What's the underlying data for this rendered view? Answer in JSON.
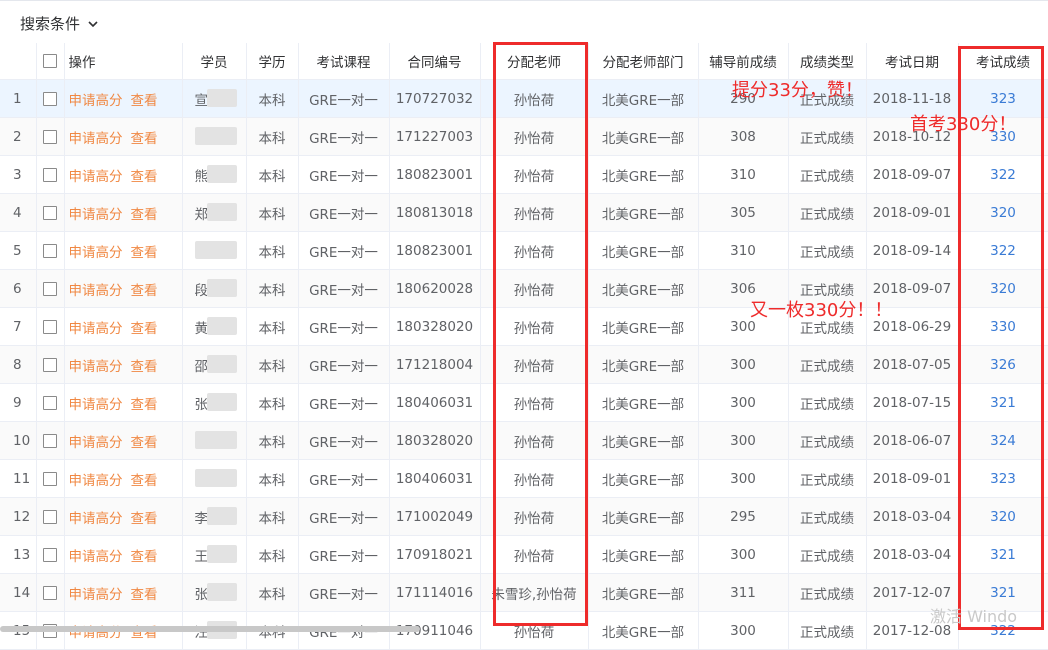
{
  "filter": {
    "label": "搜索条件"
  },
  "table": {
    "headers": {
      "ops": "操作",
      "student": "学员",
      "degree": "学历",
      "course": "考试课程",
      "contract": "合同编号",
      "teacher": "分配老师",
      "dept": "分配老师部门",
      "prescore": "辅导前成绩",
      "scoretype": "成绩类型",
      "date": "考试日期",
      "score": "考试成绩"
    },
    "actions": {
      "apply": "申请高分",
      "view": "查看"
    },
    "rows": [
      {
        "idx": "1",
        "name": "宣",
        "degree": "本科",
        "course": "GRE一对一",
        "contract": "170727032",
        "teacher": "孙怡荷",
        "dept": "北美GRE一部",
        "prescore": "290",
        "type": "正式成绩",
        "date": "2018-11-18",
        "score": "323"
      },
      {
        "idx": "2",
        "name": "",
        "degree": "本科",
        "course": "GRE一对一",
        "contract": "171227003",
        "teacher": "孙怡荷",
        "dept": "北美GRE一部",
        "prescore": "308",
        "type": "正式成绩",
        "date": "2018-10-12",
        "score": "330"
      },
      {
        "idx": "3",
        "name": "熊",
        "degree": "本科",
        "course": "GRE一对一",
        "contract": "180823001",
        "teacher": "孙怡荷",
        "dept": "北美GRE一部",
        "prescore": "310",
        "type": "正式成绩",
        "date": "2018-09-07",
        "score": "322"
      },
      {
        "idx": "4",
        "name": "郑",
        "degree": "本科",
        "course": "GRE一对一",
        "contract": "180813018",
        "teacher": "孙怡荷",
        "dept": "北美GRE一部",
        "prescore": "305",
        "type": "正式成绩",
        "date": "2018-09-01",
        "score": "320"
      },
      {
        "idx": "5",
        "name": "",
        "degree": "本科",
        "course": "GRE一对一",
        "contract": "180823001",
        "teacher": "孙怡荷",
        "dept": "北美GRE一部",
        "prescore": "310",
        "type": "正式成绩",
        "date": "2018-09-14",
        "score": "322"
      },
      {
        "idx": "6",
        "name": "段",
        "degree": "本科",
        "course": "GRE一对一",
        "contract": "180620028",
        "teacher": "孙怡荷",
        "dept": "北美GRE一部",
        "prescore": "306",
        "type": "正式成绩",
        "date": "2018-09-07",
        "score": "320"
      },
      {
        "idx": "7",
        "name": "黄",
        "degree": "本科",
        "course": "GRE一对一",
        "contract": "180328020",
        "teacher": "孙怡荷",
        "dept": "北美GRE一部",
        "prescore": "300",
        "type": "正式成绩",
        "date": "2018-06-29",
        "score": "330"
      },
      {
        "idx": "8",
        "name": "邵",
        "degree": "本科",
        "course": "GRE一对一",
        "contract": "171218004",
        "teacher": "孙怡荷",
        "dept": "北美GRE一部",
        "prescore": "300",
        "type": "正式成绩",
        "date": "2018-07-05",
        "score": "326"
      },
      {
        "idx": "9",
        "name": "张",
        "degree": "本科",
        "course": "GRE一对一",
        "contract": "180406031",
        "teacher": "孙怡荷",
        "dept": "北美GRE一部",
        "prescore": "300",
        "type": "正式成绩",
        "date": "2018-07-15",
        "score": "321"
      },
      {
        "idx": "10",
        "name": "",
        "degree": "本科",
        "course": "GRE一对一",
        "contract": "180328020",
        "teacher": "孙怡荷",
        "dept": "北美GRE一部",
        "prescore": "300",
        "type": "正式成绩",
        "date": "2018-06-07",
        "score": "324"
      },
      {
        "idx": "11",
        "name": "",
        "degree": "本科",
        "course": "GRE一对一",
        "contract": "180406031",
        "teacher": "孙怡荷",
        "dept": "北美GRE一部",
        "prescore": "300",
        "type": "正式成绩",
        "date": "2018-09-01",
        "score": "323"
      },
      {
        "idx": "12",
        "name": "李",
        "degree": "本科",
        "course": "GRE一对一",
        "contract": "171002049",
        "teacher": "孙怡荷",
        "dept": "北美GRE一部",
        "prescore": "295",
        "type": "正式成绩",
        "date": "2018-03-04",
        "score": "320"
      },
      {
        "idx": "13",
        "name": "王",
        "degree": "本科",
        "course": "GRE一对一",
        "contract": "170918021",
        "teacher": "孙怡荷",
        "dept": "北美GRE一部",
        "prescore": "300",
        "type": "正式成绩",
        "date": "2018-03-04",
        "score": "321"
      },
      {
        "idx": "14",
        "name": "张",
        "degree": "本科",
        "course": "GRE一对一",
        "contract": "171114016",
        "teacher": "朱雪珍,孙怡荷",
        "dept": "北美GRE一部",
        "prescore": "311",
        "type": "正式成绩",
        "date": "2017-12-07",
        "score": "321"
      },
      {
        "idx": "15",
        "name": "汪",
        "degree": "本科",
        "course": "GRE一对一",
        "contract": "170911046",
        "teacher": "孙怡荷",
        "dept": "北美GRE一部",
        "prescore": "300",
        "type": "正式成绩",
        "date": "2017-12-08",
        "score": "322"
      }
    ]
  },
  "annotations": {
    "a1": "提分33分，赞！",
    "a2": "首考330分！",
    "a3": "又一枚330分！！"
  },
  "watermark": "激活 Windo",
  "colors": {
    "action": "#f08843",
    "score": "#3a7bd5",
    "highlight": "#ee2b2b",
    "selected_row": "#ecf5ff"
  }
}
